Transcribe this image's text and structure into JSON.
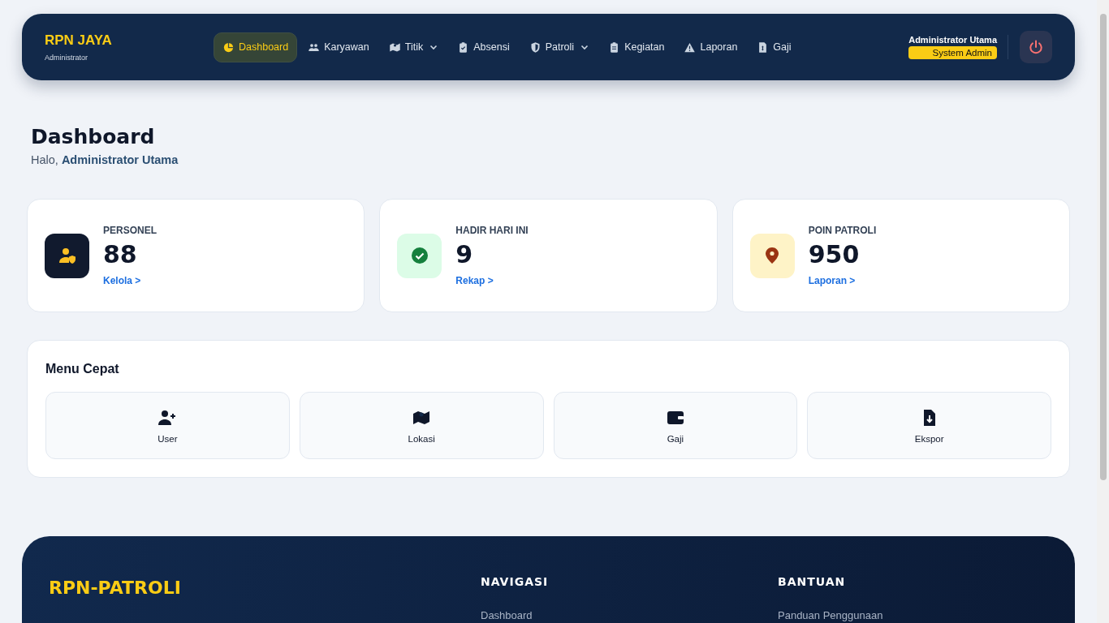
{
  "brand": {
    "title": "RPN JAYA",
    "subtitle": "Administrator"
  },
  "nav": [
    {
      "label": "Dashboard",
      "selected": true,
      "dropdown": false
    },
    {
      "label": "Karyawan",
      "selected": false,
      "dropdown": false
    },
    {
      "label": "Titik",
      "selected": false,
      "dropdown": true
    },
    {
      "label": "Absensi",
      "selected": false,
      "dropdown": false
    },
    {
      "label": "Patroli",
      "selected": false,
      "dropdown": true
    },
    {
      "label": "Kegiatan",
      "selected": false,
      "dropdown": false
    },
    {
      "label": "Laporan",
      "selected": false,
      "dropdown": false
    },
    {
      "label": "Gaji",
      "selected": false,
      "dropdown": false
    }
  ],
  "user": {
    "name": "Administrator Utama",
    "role": "System Admin"
  },
  "page": {
    "title": "Dashboard",
    "greeting": "Halo, **Administrator Utama**"
  },
  "stats": [
    {
      "label": "PERSONEL",
      "value": "88",
      "link": "Kelola >",
      "color": "#111a2e"
    },
    {
      "label": "HADIR HARI INI",
      "value": "9",
      "link": "Rekap >",
      "color": "#dcfce7"
    },
    {
      "label": "POIN PATROLI",
      "value": "950",
      "link": "Laporan >",
      "color": "#fef3c7"
    }
  ],
  "quick_menu": {
    "title": "Menu Cepat",
    "items": [
      {
        "label": "User"
      },
      {
        "label": "Lokasi"
      },
      {
        "label": "Gaji"
      },
      {
        "label": "Ekspor"
      }
    ]
  },
  "footer": {
    "brand": "RPN-PATROLI",
    "columns": [
      {
        "title": "NAVIGASI",
        "links": [
          "Dashboard"
        ]
      },
      {
        "title": "BANTUAN",
        "links": [
          "Panduan Penggunaan"
        ]
      }
    ]
  }
}
